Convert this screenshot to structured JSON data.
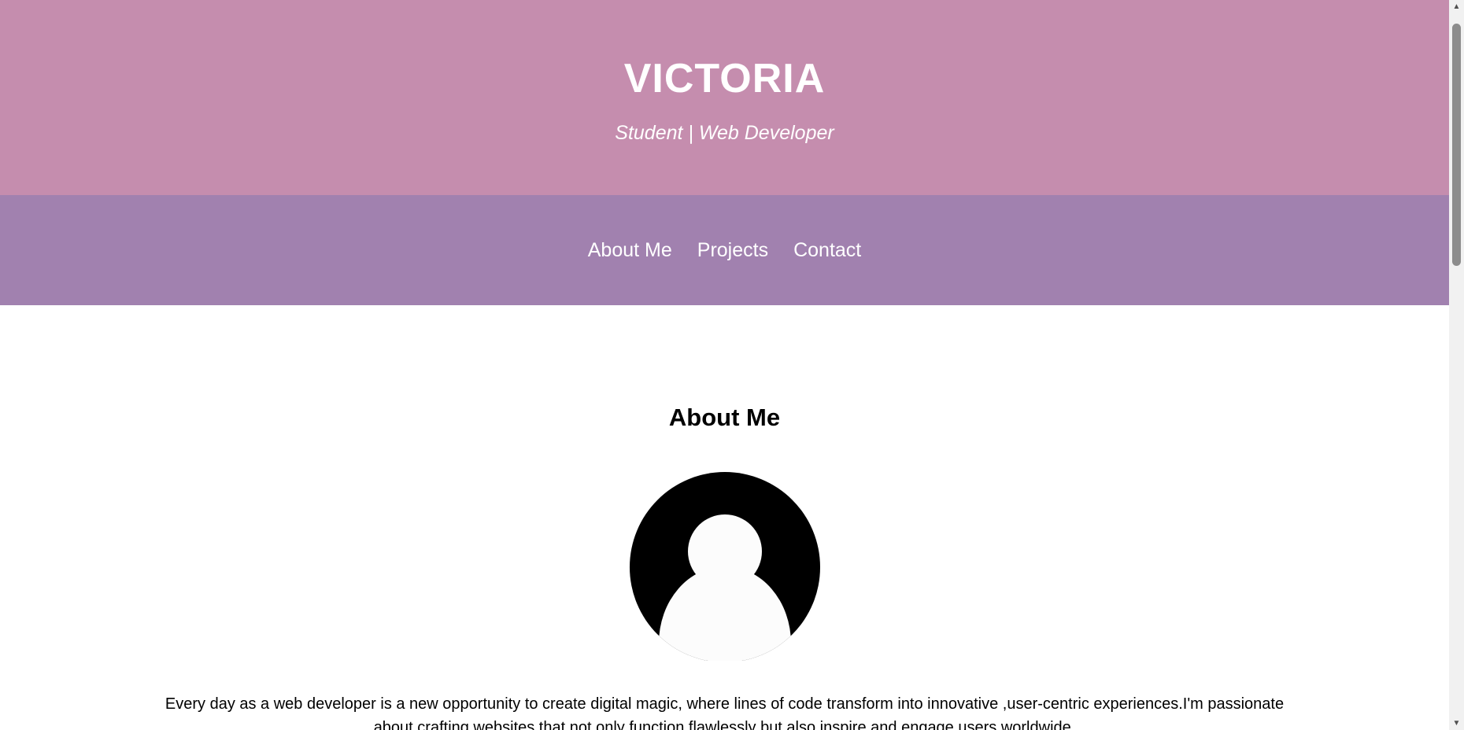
{
  "header": {
    "title": "VICTORIA",
    "tagline": "Student | Web Developer"
  },
  "nav": {
    "items": [
      {
        "label": "About Me"
      },
      {
        "label": "Projects"
      },
      {
        "label": "Contact"
      }
    ]
  },
  "about": {
    "heading": "About Me",
    "avatar_icon": "user-avatar-icon",
    "text": "Every day as a web developer is a new opportunity to create digital magic, where lines of code transform into innovative ,user-centric experiences.I'm passionate about crafting websites that not only function flawlessly but also inspire and engage users worldwide."
  },
  "colors": {
    "header_bg": "#c58dae",
    "nav_bg": "#a181af",
    "text_light": "#ffffff",
    "text_dark": "#000000"
  },
  "scrollbar": {
    "up_icon": "scroll-up-arrow-icon",
    "down_icon": "scroll-down-arrow-icon"
  }
}
